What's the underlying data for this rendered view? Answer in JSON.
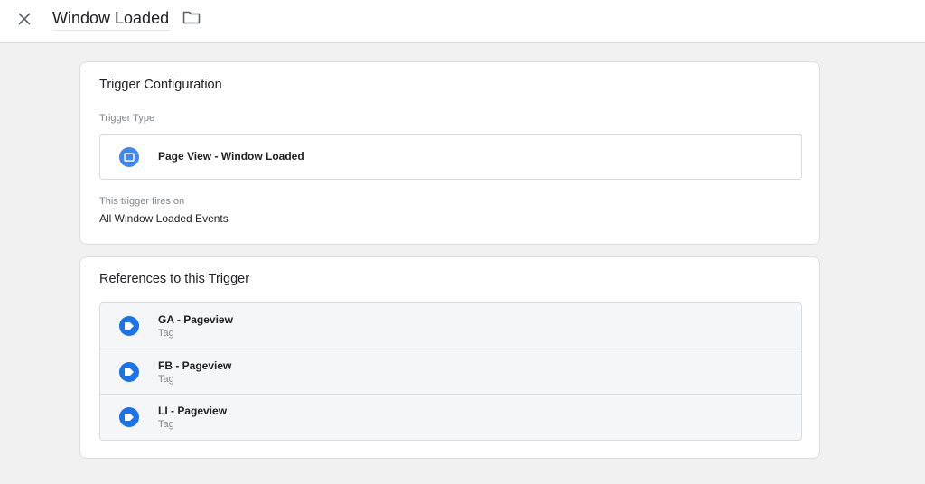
{
  "header": {
    "title": "Window Loaded",
    "close_icon": "close-icon",
    "folder_icon": "folder-icon"
  },
  "trigger_config": {
    "title": "Trigger Configuration",
    "type_label": "Trigger Type",
    "type_name": "Page View - Window Loaded",
    "type_icon": "window-loaded-icon",
    "fires_on_label": "This trigger fires on",
    "fires_on_value": "All Window Loaded Events"
  },
  "references": {
    "title": "References to this Trigger",
    "items": [
      {
        "name": "GA - Pageview",
        "type": "Tag"
      },
      {
        "name": "FB - Pageview",
        "type": "Tag"
      },
      {
        "name": "LI - Pageview",
        "type": "Tag"
      }
    ]
  },
  "colors": {
    "accent": "#4285f4",
    "tag_blue": "#1a73e8",
    "background": "#f1f1f1"
  }
}
